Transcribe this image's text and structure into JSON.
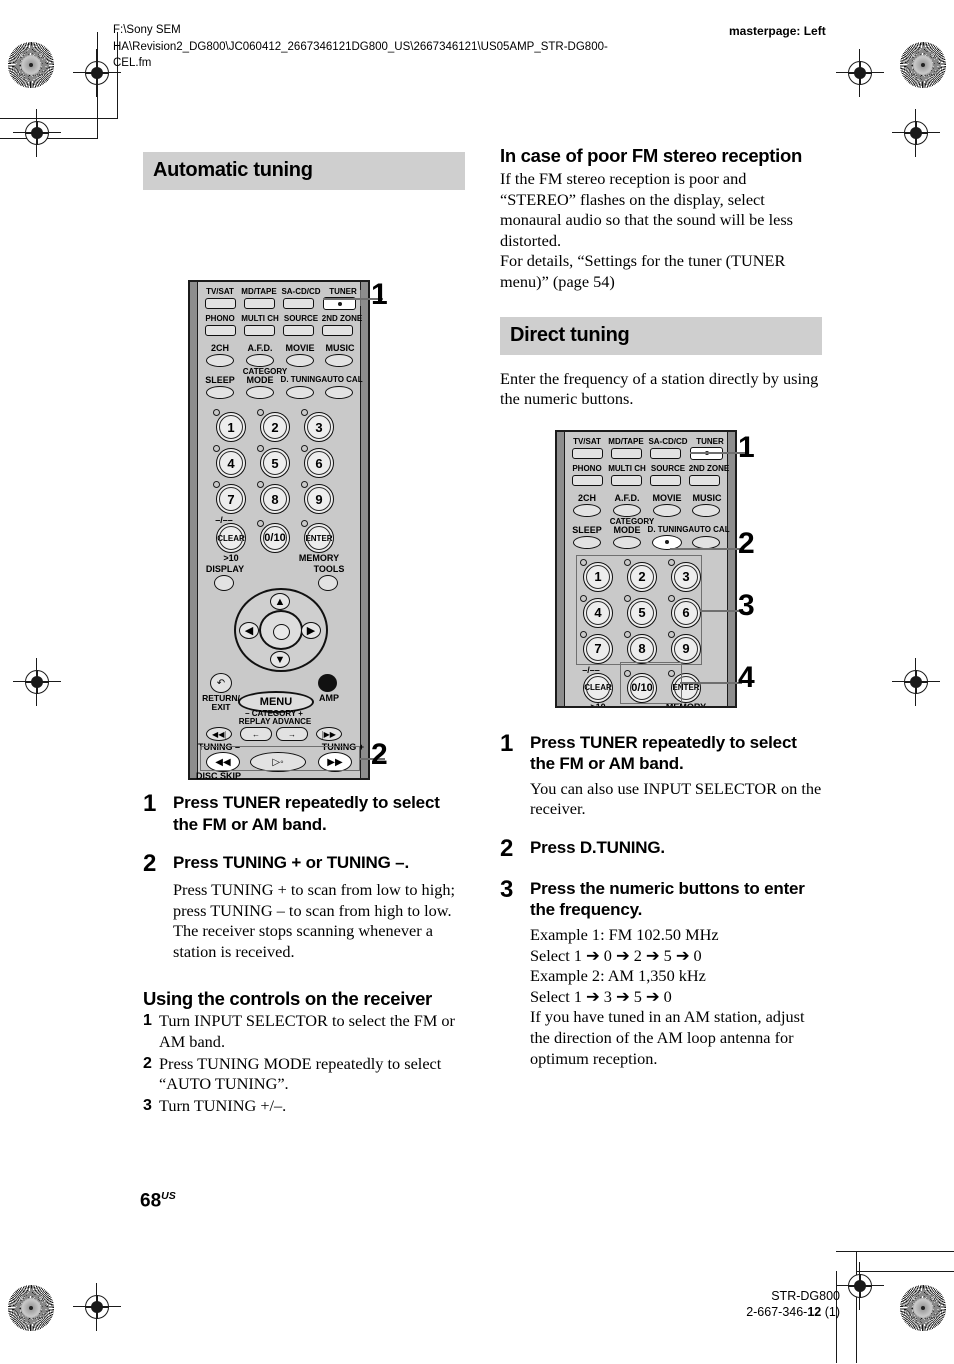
{
  "header": {
    "file_path_line1": "F:\\Sony SEM",
    "file_path_line2": "HA\\Revision2_DG800\\JC060412_2667346121DG800_US\\2667346121\\US05AMP_STR-DG800-",
    "file_path_line3": "CEL.fm",
    "masterpage": "masterpage: Left"
  },
  "left_column": {
    "section_title": "Automatic tuning",
    "callouts": [
      "1",
      "2"
    ],
    "steps": [
      {
        "num": "1",
        "heading": "Press TUNER repeatedly to select the FM or AM band.",
        "body": []
      },
      {
        "num": "2",
        "heading": "Press TUNING + or TUNING –.",
        "body": [
          "Press TUNING + to scan from low to high; press TUNING – to scan from high to low.",
          "The receiver stops scanning whenever a station is received."
        ]
      }
    ],
    "subsection": {
      "heading": "Using the controls on the receiver",
      "items": [
        {
          "n": "1",
          "text": "Turn INPUT SELECTOR to select the FM or AM band."
        },
        {
          "n": "2",
          "text": "Press TUNING MODE repeatedly to select “AUTO TUNING”."
        },
        {
          "n": "3",
          "text": "Turn TUNING +/–."
        }
      ]
    }
  },
  "right_column": {
    "subsection_heading": "In case of poor FM stereo reception",
    "paragraphs": [
      "If the FM stereo reception is poor and “STEREO” flashes on the display, select monaural audio so that the sound will be less distorted.",
      "For details, “Settings for the tuner (TUNER menu)” (page 54)"
    ],
    "section_title": "Direct tuning",
    "intro": "Enter the frequency of a station directly by using the numeric buttons.",
    "callouts": [
      "1",
      "2",
      "3",
      "4"
    ],
    "steps": [
      {
        "num": "1",
        "heading": "Press TUNER repeatedly to select the FM or AM band.",
        "body": [
          "You can also use INPUT SELECTOR on the receiver."
        ]
      },
      {
        "num": "2",
        "heading": "Press D.TUNING.",
        "body": []
      },
      {
        "num": "3",
        "heading": "Press the numeric buttons to enter the frequency.",
        "body": [
          "Example 1: FM 102.50 MHz",
          "Select 1 ➔ 0 ➔ 2 ➔ 5 ➔ 0",
          "Example 2: AM 1,350 kHz",
          "Select 1 ➔ 3 ➔ 5 ➔ 0",
          "If you have tuned in an AM station, adjust the direction of the AM loop antenna for optimum reception."
        ]
      }
    ]
  },
  "remote": {
    "row1": [
      "TV/SAT",
      "MD/TAPE",
      "SA-CD/CD",
      "TUNER"
    ],
    "row2": [
      "PHONO",
      "MULTI CH",
      "SOURCE",
      "2ND ZONE"
    ],
    "row3": [
      "2CH",
      "A.F.D.",
      "MOVIE",
      "MUSIC"
    ],
    "row4": [
      "SLEEP",
      "MODE",
      "D. TUNING",
      "AUTO CAL"
    ],
    "category_label": "CATEGORY",
    "numeric": [
      "1",
      "2",
      "3",
      "4",
      "5",
      "6",
      "7",
      "8",
      "9"
    ],
    "clear": "CLEAR",
    "clear_above": "–/––",
    "clear_below": ">10",
    "zero": "0/10",
    "enter": "ENTER",
    "enter_below": "MEMORY",
    "display": "DISPLAY",
    "tools": "TOOLS",
    "return_exit_line1": "RETURN/",
    "return_exit_line2": "EXIT",
    "menu": "MENU",
    "amp": "AMP",
    "category_pm": "– CATEGORY +",
    "replay_advance": "REPLAY ADVANCE",
    "tuning_minus": "TUNING –",
    "tuning_plus": "TUNING +",
    "disc_skip": "DISC SKIP"
  },
  "footer": {
    "page_number": "68",
    "page_suffix": "US",
    "model": "STR-DG800",
    "doc_number_prefix": "2-667-346-",
    "doc_number_bold": "12",
    "doc_number_suffix": " (1)"
  },
  "colors": {
    "section_bar_bg": "#cfcfcf",
    "remote_body": "#c9c9c9",
    "button_face": "#e2e2e2",
    "highlight_button": "#ffffff",
    "callout_gray": "#6f6f6f"
  }
}
